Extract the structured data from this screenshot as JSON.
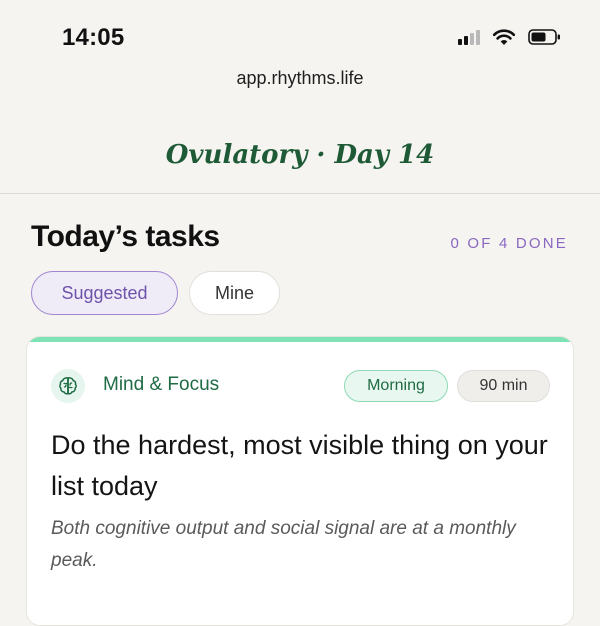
{
  "status_bar": {
    "time": "14:05",
    "icons": [
      "cellular-signal-icon",
      "wifi-icon",
      "battery-icon"
    ]
  },
  "browser": {
    "url": "app.rhythms.life"
  },
  "header": {
    "phase_title": "Ovulatory · Day 14"
  },
  "tasks": {
    "heading": "Today’s tasks",
    "progress": "0 OF 4 DONE",
    "tabs": [
      {
        "label": "Suggested",
        "selected": true
      },
      {
        "label": "Mine",
        "selected": false
      }
    ]
  },
  "task_card": {
    "category_icon": "brain-icon",
    "category": "Mind & Focus",
    "time_of_day": "Morning",
    "duration": "90 min",
    "title": "Do the hardest, most visible thing on your list today",
    "description": "Both cognitive output and social signal are at a monthly peak."
  },
  "colors": {
    "background": "#f5f4f1",
    "brand_green": "#1e5a36",
    "accent_purple": "#8a67c2",
    "card_accent_mint": "#7fe3b5"
  }
}
